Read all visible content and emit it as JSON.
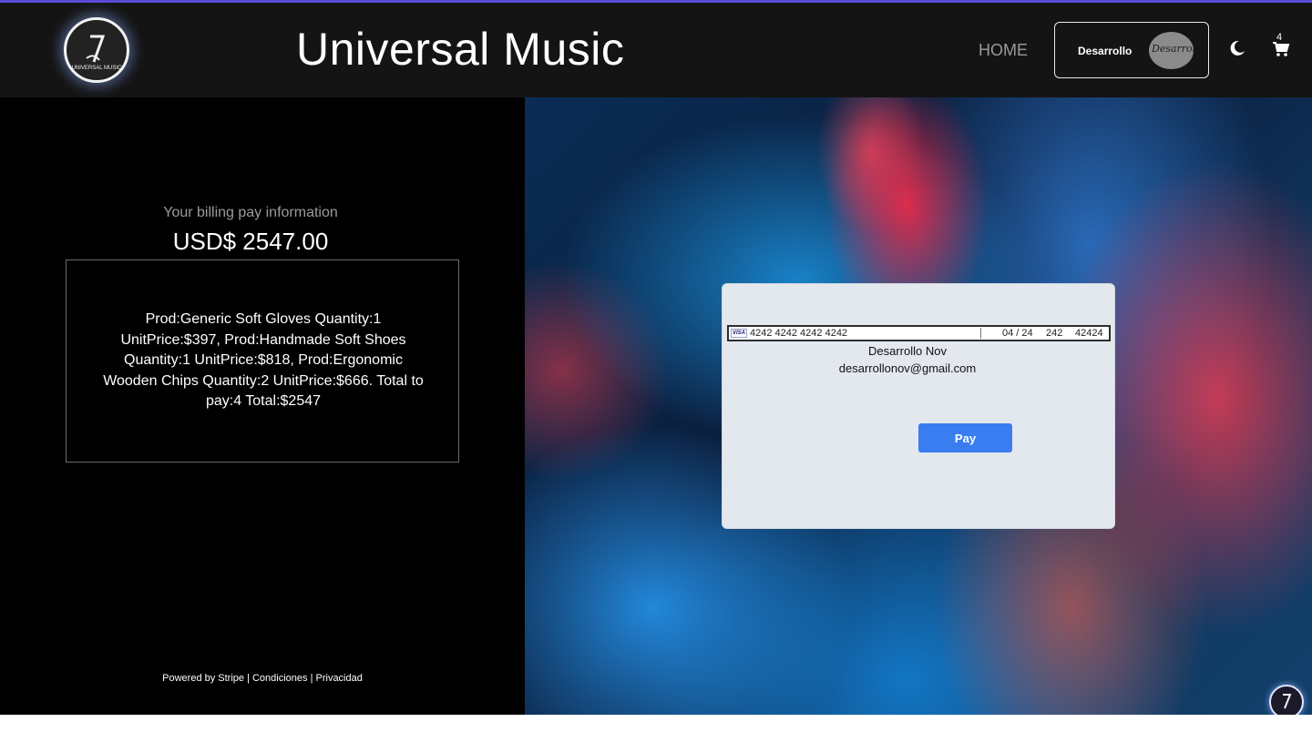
{
  "header": {
    "brand": "Universal Music",
    "logo_text": "UNIVERSAL MUSIC",
    "nav_home": "HOME",
    "user_name": "Desarrollo",
    "avatar_text": "Desarrollo",
    "cart_count": "4",
    "icons": [
      "logo-icon",
      "moon-icon",
      "cart-icon"
    ]
  },
  "billing": {
    "title": "Your billing pay information",
    "amount": "USD$ 2547.00",
    "summary": "Prod:Generic Soft Gloves Quantity:1 UnitPrice:$397, Prod:Handmade Soft Shoes Quantity:1 UnitPrice:$818, Prod:Ergonomic Wooden Chips Quantity:2 UnitPrice:$666. Total to pay:4 Total:$2547",
    "footer": "Powered by Stripe | Condiciones | Privacidad"
  },
  "payment": {
    "card_brand": "VISA",
    "card_number": "4242 4242 4242 4242",
    "expiry": "04 / 24",
    "cvc": "242",
    "zip": "42424",
    "name": "Desarrollo Nov",
    "email": "desarrollonov@gmail.com",
    "pay_label": "Pay"
  },
  "colors": {
    "accent_line": "#5b4bd6",
    "pay_button": "#3a7df0",
    "header_bg": "#141414"
  }
}
